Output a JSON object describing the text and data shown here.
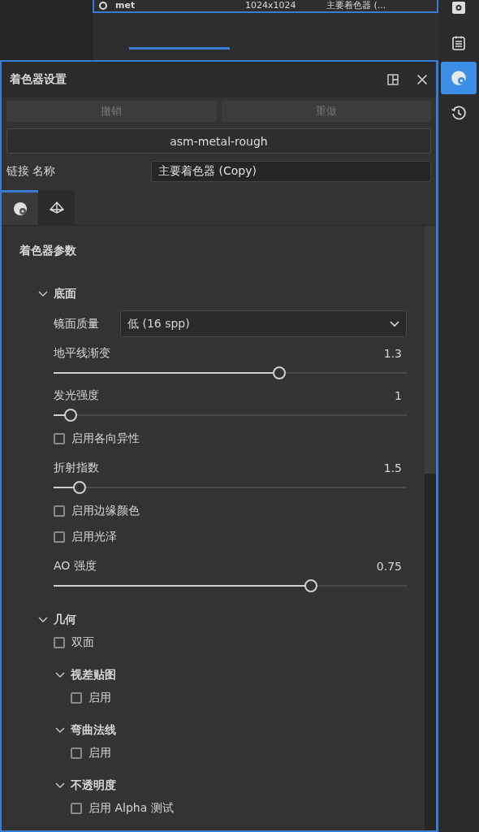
{
  "file_row": {
    "name": "met",
    "size": "1024x1024",
    "shader": "主要着色器 (..."
  },
  "sidebar": {
    "items": [
      {
        "kind": "gear",
        "selected": false
      },
      {
        "kind": "list",
        "selected": false
      },
      {
        "kind": "shader",
        "selected": true
      },
      {
        "kind": "history",
        "selected": false
      }
    ]
  },
  "panel": {
    "title": "着色器设置",
    "undo": {
      "label": "撤销",
      "disabled": true
    },
    "redo": {
      "label": "重做",
      "disabled": true
    },
    "shader_button": "asm-metal-rough",
    "link_label": "链接 名称",
    "name_value": "主要着色器 (Copy)",
    "tabs": [
      {
        "kind": "shader",
        "selected": true
      },
      {
        "kind": "geometry",
        "selected": false
      }
    ],
    "section_title": "着色器参数",
    "groups": [
      {
        "title": "底面",
        "expanded": true,
        "items": [
          {
            "kind": "dropdown",
            "label": "镜面质量",
            "value": "低 (16 spp)"
          },
          {
            "kind": "slider",
            "label": "地平线渐变",
            "reading": "1.3",
            "level": 0.645
          },
          {
            "kind": "slider",
            "label": "发光强度",
            "reading": "1",
            "level": 0.03
          },
          {
            "kind": "checkbox",
            "label": "启用各向异性",
            "checked": false
          },
          {
            "kind": "slider",
            "label": "折射指数",
            "reading": "1.5",
            "level": 0.058
          },
          {
            "kind": "checkbox",
            "label": "启用边缘颜色",
            "checked": false
          },
          {
            "kind": "checkbox",
            "label": "启用光泽",
            "checked": false
          },
          {
            "kind": "slider",
            "label": "AO 强度",
            "reading": "0.75",
            "level": 0.738
          }
        ]
      },
      {
        "title": "几何",
        "expanded": true,
        "items": [
          {
            "kind": "checkbox",
            "label": "双面",
            "checked": false
          },
          {
            "kind": "group",
            "title": "视差贴图",
            "expanded": true,
            "items": [
              {
                "kind": "checkbox",
                "label": "启用",
                "checked": false
              }
            ]
          },
          {
            "kind": "group",
            "title": "弯曲法线",
            "expanded": true,
            "items": [
              {
                "kind": "checkbox",
                "label": "启用",
                "checked": false
              }
            ]
          },
          {
            "kind": "group",
            "title": "不透明度",
            "expanded": true,
            "items": [
              {
                "kind": "checkbox",
                "label": "启用 Alpha 测试",
                "checked": false
              }
            ]
          }
        ]
      }
    ]
  }
}
